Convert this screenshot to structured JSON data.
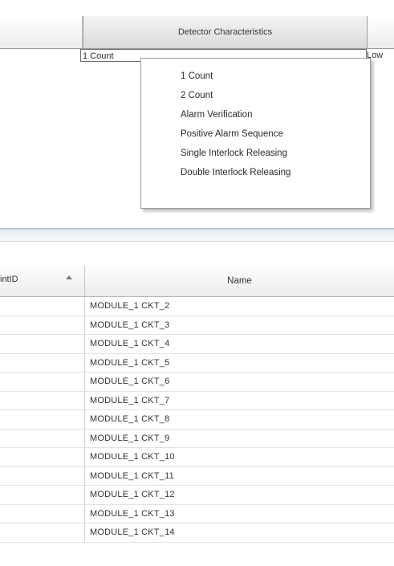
{
  "top_grid": {
    "column_header": "Detector Characteristics",
    "cell_value": "1 Count",
    "next_cell_value": "Low"
  },
  "dropdown": {
    "options": [
      "1 Count",
      "2 Count",
      "Alarm Verification",
      "Positive Alarm Sequence",
      "Single Interlock Releasing",
      "Double Interlock Releasing"
    ]
  },
  "bottom_grid": {
    "point_id_header": "intID",
    "sort_icon": "sort-ascending-icon",
    "name_header": "Name",
    "rows": [
      "MODULE_1 CKT_2",
      "MODULE_1 CKT_3",
      "MODULE_1 CKT_4",
      "MODULE_1 CKT_5",
      "MODULE_1 CKT_6",
      "MODULE_1 CKT_7",
      "MODULE_1 CKT_8",
      "MODULE_1 CKT_9",
      "MODULE_1 CKT_10",
      "MODULE_1 CKT_11",
      "MODULE_1 CKT_12",
      "MODULE_1 CKT_13",
      "MODULE_1 CKT_14"
    ]
  }
}
